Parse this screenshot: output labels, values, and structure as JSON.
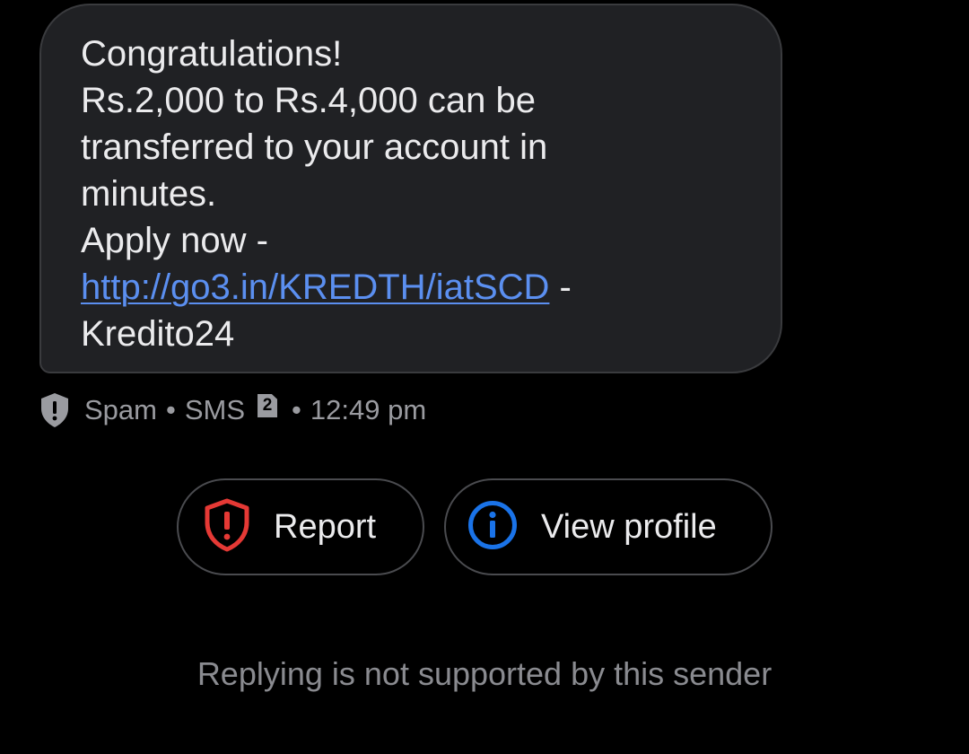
{
  "message": {
    "lines": [
      "Congratulations!",
      "Rs.2,000 to Rs.4,000 can be",
      "transferred to your account in",
      "minutes.",
      "Apply now -"
    ],
    "link_text": "http://go3.in/KREDTH/iatSCD",
    "link_suffix": " -",
    "sender_signature": "Kredito24"
  },
  "meta": {
    "icon": "shield-alert-icon",
    "category": "Spam",
    "separator": "•",
    "channel": "SMS",
    "sim_slot": "2",
    "time": "12:49 pm"
  },
  "actions": {
    "report": {
      "label": "Report",
      "icon": "shield-alert-icon",
      "color": "#e53935"
    },
    "view_profile": {
      "label": "View profile",
      "icon": "info-icon",
      "color": "#1a73e8"
    }
  },
  "footer": {
    "note": "Replying is not supported by this sender"
  },
  "colors": {
    "background": "#000000",
    "bubble": "#202124",
    "link": "#5b8ff0"
  }
}
